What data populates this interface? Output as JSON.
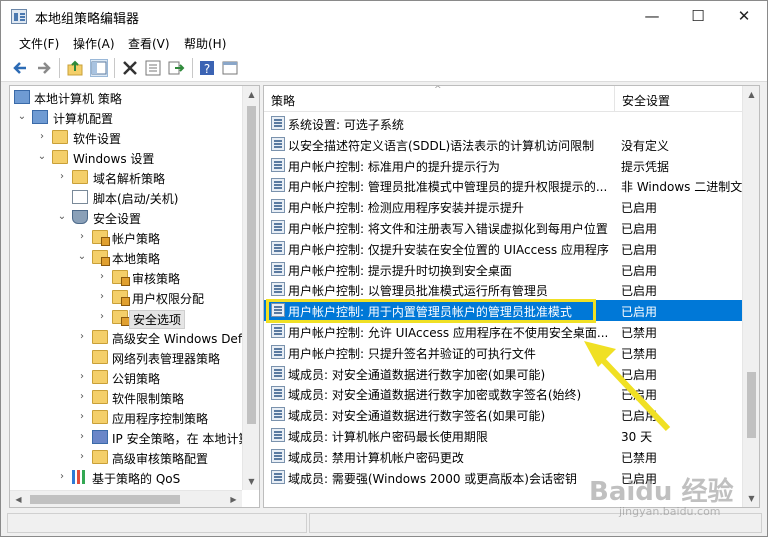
{
  "window": {
    "title": "本地组策略编辑器",
    "minimize_glyph": "—",
    "maximize_glyph": "☐",
    "close_glyph": "✕"
  },
  "menu": {
    "file": "文件(F)",
    "action": "操作(A)",
    "view": "查看(V)",
    "help": "帮助(H)"
  },
  "toolbar": {
    "back_icon": "arrow-left-icon",
    "forward_icon": "arrow-right-icon",
    "up_icon": "folder-up-icon",
    "show_tree_icon": "show-hide-tree-icon",
    "delete_icon": "delete-icon",
    "properties_icon": "properties-icon",
    "export_icon": "export-list-icon",
    "help_icon": "help-icon",
    "view_icon": "view-icon"
  },
  "tree": {
    "items": [
      {
        "label": "本地计算机 策略",
        "icon": "computer-icon"
      },
      {
        "label": "计算机配置",
        "icon": "computer-icon"
      },
      {
        "label": "软件设置",
        "icon": "folder-icon"
      },
      {
        "label": "Windows 设置",
        "icon": "folder-icon"
      },
      {
        "label": "域名解析策略",
        "icon": "folder-icon"
      },
      {
        "label": "脚本(启动/关机)",
        "icon": "script-icon"
      },
      {
        "label": "安全设置",
        "icon": "security-icon"
      },
      {
        "label": "帐户策略",
        "icon": "folder-lock-icon"
      },
      {
        "label": "本地策略",
        "icon": "folder-lock-icon"
      },
      {
        "label": "审核策略",
        "icon": "folder-lock-icon"
      },
      {
        "label": "用户权限分配",
        "icon": "folder-lock-icon"
      },
      {
        "label": "安全选项",
        "icon": "folder-lock-icon"
      },
      {
        "label": "高级安全 Windows Def",
        "icon": "folder-icon"
      },
      {
        "label": "网络列表管理器策略",
        "icon": "folder-icon"
      },
      {
        "label": "公钥策略",
        "icon": "folder-icon"
      },
      {
        "label": "软件限制策略",
        "icon": "folder-icon"
      },
      {
        "label": "应用程序控制策略",
        "icon": "folder-icon"
      },
      {
        "label": "IP 安全策略，在 本地计算",
        "icon": "ip-security-icon"
      },
      {
        "label": "高级审核策略配置",
        "icon": "folder-icon"
      },
      {
        "label": "基于策略的 QoS",
        "icon": "chart-icon"
      }
    ]
  },
  "columns": {
    "policy": "策略",
    "setting": "安全设置"
  },
  "policies": [
    {
      "name": "系统设置: 可选子系统",
      "value": ""
    },
    {
      "name": "以安全描述符定义语言(SDDL)语法表示的计算机访问限制",
      "value": "没有定义"
    },
    {
      "name": "用户帐户控制: 标准用户的提升提示行为",
      "value": "提示凭据"
    },
    {
      "name": "用户帐户控制: 管理员批准模式中管理员的提升权限提示的...",
      "value": "非 Windows 二进制文"
    },
    {
      "name": "用户帐户控制: 检测应用程序安装并提示提升",
      "value": "已启用"
    },
    {
      "name": "用户帐户控制: 将文件和注册表写入错误虚拟化到每用户位置",
      "value": "已启用"
    },
    {
      "name": "用户帐户控制: 仅提升安装在安全位置的 UIAccess 应用程序",
      "value": "已启用"
    },
    {
      "name": "用户帐户控制: 提示提升时切换到安全桌面",
      "value": "已启用"
    },
    {
      "name": "用户帐户控制: 以管理员批准模式运行所有管理员",
      "value": "已启用"
    },
    {
      "name": "用户帐户控制: 用于内置管理员帐户的管理员批准模式",
      "value": "已启用"
    },
    {
      "name": "用户帐户控制: 允许 UIAccess 应用程序在不使用安全桌面...",
      "value": "已禁用"
    },
    {
      "name": "用户帐户控制: 只提升签名并验证的可执行文件",
      "value": "已禁用"
    },
    {
      "name": "域成员: 对安全通道数据进行数字加密(如果可能)",
      "value": "已启用"
    },
    {
      "name": "域成员: 对安全通道数据进行数字加密或数字签名(始终)",
      "value": "已启用"
    },
    {
      "name": "域成员: 对安全通道数据进行数字签名(如果可能)",
      "value": "已启用"
    },
    {
      "name": "域成员: 计算机帐户密码最长使用期限",
      "value": "30 天"
    },
    {
      "name": "域成员: 禁用计算机帐户密码更改",
      "value": "已禁用"
    },
    {
      "name": "域成员: 需要强(Windows 2000 或更高版本)会话密钥",
      "value": "已启用"
    }
  ],
  "selected_index": 9,
  "colors": {
    "selection": "#0078d7",
    "annotation": "#f0e024"
  },
  "watermark": {
    "main": "Baidu 经验",
    "sub": "jingyan.baidu.com"
  }
}
